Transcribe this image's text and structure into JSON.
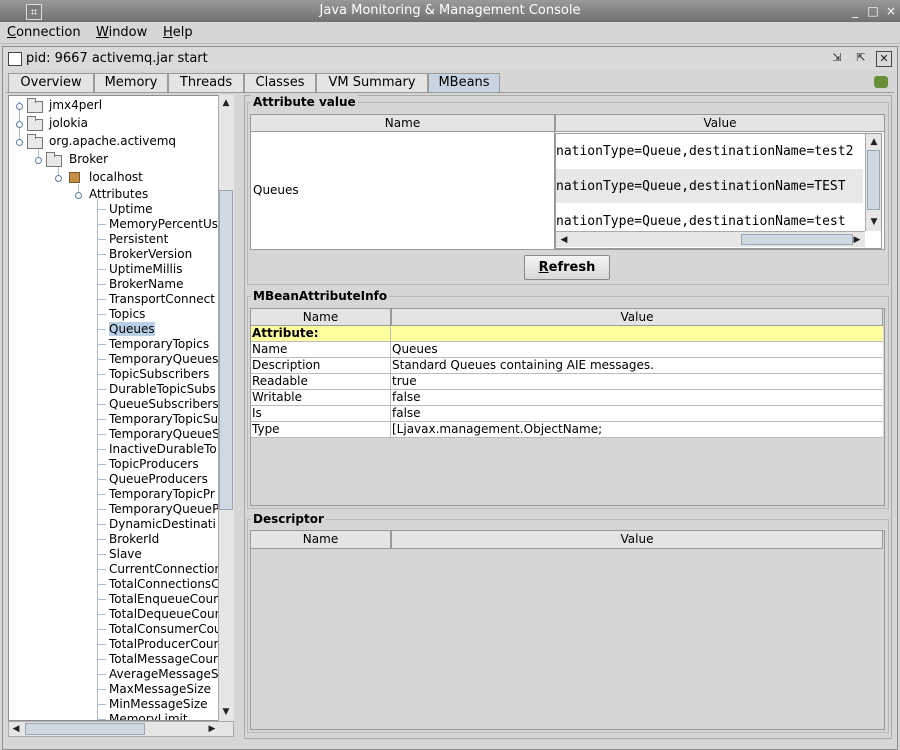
{
  "window": {
    "title": "Java Monitoring & Management Console"
  },
  "menu": {
    "items": [
      {
        "label": "Connection",
        "mnemonic": "C",
        "rest": "onnection"
      },
      {
        "label": "Window",
        "mnemonic": "W",
        "rest": "indow"
      },
      {
        "label": "Help",
        "mnemonic": "H",
        "rest": "elp"
      }
    ]
  },
  "frame": {
    "title": "pid: 9667 activemq.jar start"
  },
  "tabs": [
    {
      "label": "Overview"
    },
    {
      "label": "Memory"
    },
    {
      "label": "Threads"
    },
    {
      "label": "Classes"
    },
    {
      "label": "VM Summary"
    },
    {
      "label": "MBeans",
      "selected": true
    }
  ],
  "tree": {
    "nodes": [
      {
        "label": "jmx4perl",
        "kind": "folder"
      },
      {
        "label": "jolokia",
        "kind": "folder"
      },
      {
        "label": "org.apache.activemq",
        "kind": "folder"
      },
      {
        "label": "Broker",
        "kind": "folder"
      },
      {
        "label": "localhost",
        "kind": "bean"
      },
      {
        "label": "Attributes",
        "kind": "group"
      }
    ],
    "attributes": [
      "Uptime",
      "MemoryPercentUs",
      "Persistent",
      "BrokerVersion",
      "UptimeMillis",
      "BrokerName",
      "TransportConnect",
      "Topics",
      "Queues",
      "TemporaryTopics",
      "TemporaryQueues",
      "TopicSubscribers",
      "DurableTopicSubs",
      "QueueSubscribers",
      "TemporaryTopicSu",
      "TemporaryQueueS",
      "InactiveDurableTo",
      "TopicProducers",
      "QueueProducers",
      "TemporaryTopicPr",
      "TemporaryQueueP",
      "DynamicDestinati",
      "BrokerId",
      "Slave",
      "CurrentConnection",
      "TotalConnectionsC",
      "TotalEnqueueCour",
      "TotalDequeueCour",
      "TotalConsumerCou",
      "TotalProducerCour",
      "TotalMessageCour",
      "AverageMessageS",
      "MaxMessageSize",
      "MinMessageSize",
      "MemoryLimit"
    ],
    "selected": "Queues"
  },
  "attribute_value": {
    "title": "Attribute value",
    "col_name": "Name",
    "col_value": "Value",
    "name": "Queues",
    "values": [
      "nationType=Queue,destinationName=test2",
      "nationType=Queue,destinationName=TEST",
      "nationType=Queue,destinationName=test"
    ],
    "refresh_label": "Refresh",
    "refresh_mnemonic": "R",
    "refresh_rest": "efresh"
  },
  "mbean_info": {
    "title": "MBeanAttributeInfo",
    "col_name": "Name",
    "col_value": "Value",
    "header_row": "Attribute:",
    "rows": [
      {
        "name": "Name",
        "value": "Queues"
      },
      {
        "name": "Description",
        "value": "Standard Queues containing AIE messages."
      },
      {
        "name": "Readable",
        "value": "true"
      },
      {
        "name": "Writable",
        "value": "false"
      },
      {
        "name": "Is",
        "value": "false"
      },
      {
        "name": "Type",
        "value": "[Ljavax.management.ObjectName;"
      }
    ]
  },
  "descriptor": {
    "title": "Descriptor",
    "col_name": "Name",
    "col_value": "Value"
  },
  "colors": {
    "selected_tab": "#c8d4e2",
    "highlight_row": "#ffffa0",
    "tree_selection": "#b8cfe5"
  }
}
